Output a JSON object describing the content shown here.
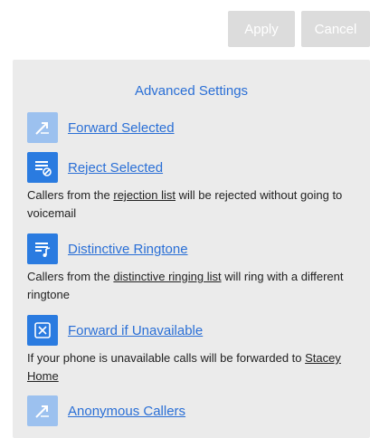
{
  "toolbar": {
    "apply_label": "Apply",
    "cancel_label": "Cancel"
  },
  "panel": {
    "title": "Advanced Settings",
    "items": [
      {
        "label": "Forward Selected",
        "icon": "forward-arrow-icon",
        "state": "disabled"
      },
      {
        "label": "Reject Selected",
        "icon": "reject-list-icon",
        "state": "enabled",
        "desc_pre": "Callers from the ",
        "desc_link": "rejection list",
        "desc_post": " will be rejected without going to voicemail"
      },
      {
        "label": "Distinctive Ringtone",
        "icon": "ringtone-list-icon",
        "state": "enabled",
        "desc_pre": "Callers from the ",
        "desc_link": "distinctive ringing list",
        "desc_post": " will ring with a different ringtone"
      },
      {
        "label": "Forward if Unavailable",
        "icon": "unavailable-forward-icon",
        "state": "enabled",
        "desc_pre": "If your phone is unavailable calls will be forwarded to ",
        "desc_link": "Stacey Home",
        "desc_post": ""
      },
      {
        "label": "Anonymous Callers",
        "icon": "anonymous-caller-icon",
        "state": "disabled"
      }
    ]
  },
  "colors": {
    "accent": "#2a6fd6",
    "icon_active": "#2a7be0",
    "icon_disabled": "#9cc1ef",
    "button_disabled": "#dcdcdc",
    "panel_bg": "#ebebeb"
  }
}
